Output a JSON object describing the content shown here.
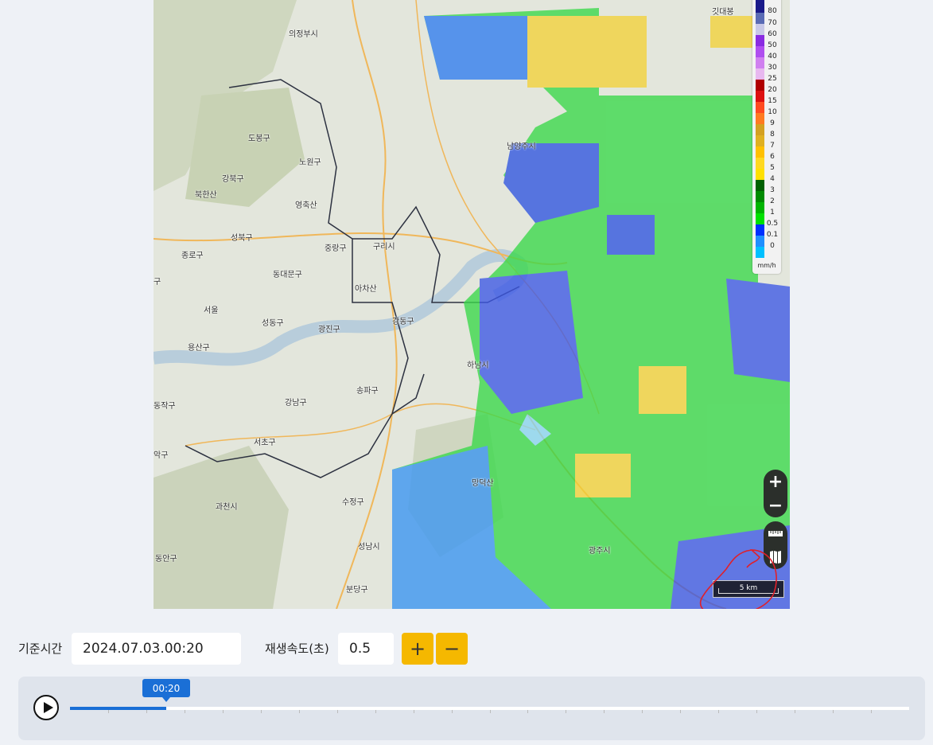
{
  "map": {
    "places": [
      {
        "name": "의정부시"
      },
      {
        "name": "도봉구"
      },
      {
        "name": "노원구"
      },
      {
        "name": "강북구"
      },
      {
        "name": "북한산"
      },
      {
        "name": "영축산"
      },
      {
        "name": "성북구"
      },
      {
        "name": "종로구"
      },
      {
        "name": "중랑구"
      },
      {
        "name": "구리시"
      },
      {
        "name": "동대문구"
      },
      {
        "name": "아차산"
      },
      {
        "name": "서울"
      },
      {
        "name": "성동구"
      },
      {
        "name": "광진구"
      },
      {
        "name": "강동구"
      },
      {
        "name": "용산구"
      },
      {
        "name": "하남시"
      },
      {
        "name": "송파구"
      },
      {
        "name": "강남구"
      },
      {
        "name": "동작구"
      },
      {
        "name": "서초구"
      },
      {
        "name": "악구"
      },
      {
        "name": "망덕산"
      },
      {
        "name": "과천시"
      },
      {
        "name": "수정구"
      },
      {
        "name": "성남시"
      },
      {
        "name": "동안구"
      },
      {
        "name": "분당구"
      },
      {
        "name": "남양주시"
      },
      {
        "name": "광주시"
      },
      {
        "name": "깃대봉"
      },
      {
        "name": "구"
      }
    ],
    "legend": {
      "ticks": [
        "80",
        "70",
        "60",
        "50",
        "40",
        "30",
        "25",
        "20",
        "15",
        "10",
        "9",
        "8",
        "7",
        "6",
        "5",
        "4",
        "3",
        "2",
        "1",
        "0.5",
        "0.1",
        "0"
      ],
      "unit": "mm/h"
    },
    "scale_label": "5 km",
    "controls": {
      "zoom_in": "+",
      "zoom_out": "−"
    }
  },
  "controls": {
    "base_time_label": "기준시간",
    "base_time_value": "2024.07.03.00:20",
    "speed_label": "재생속도(초)",
    "speed_value": "0.5",
    "speed_up": "+",
    "speed_down": "−"
  },
  "player": {
    "current_time": "00:20",
    "progress": 0.115
  }
}
